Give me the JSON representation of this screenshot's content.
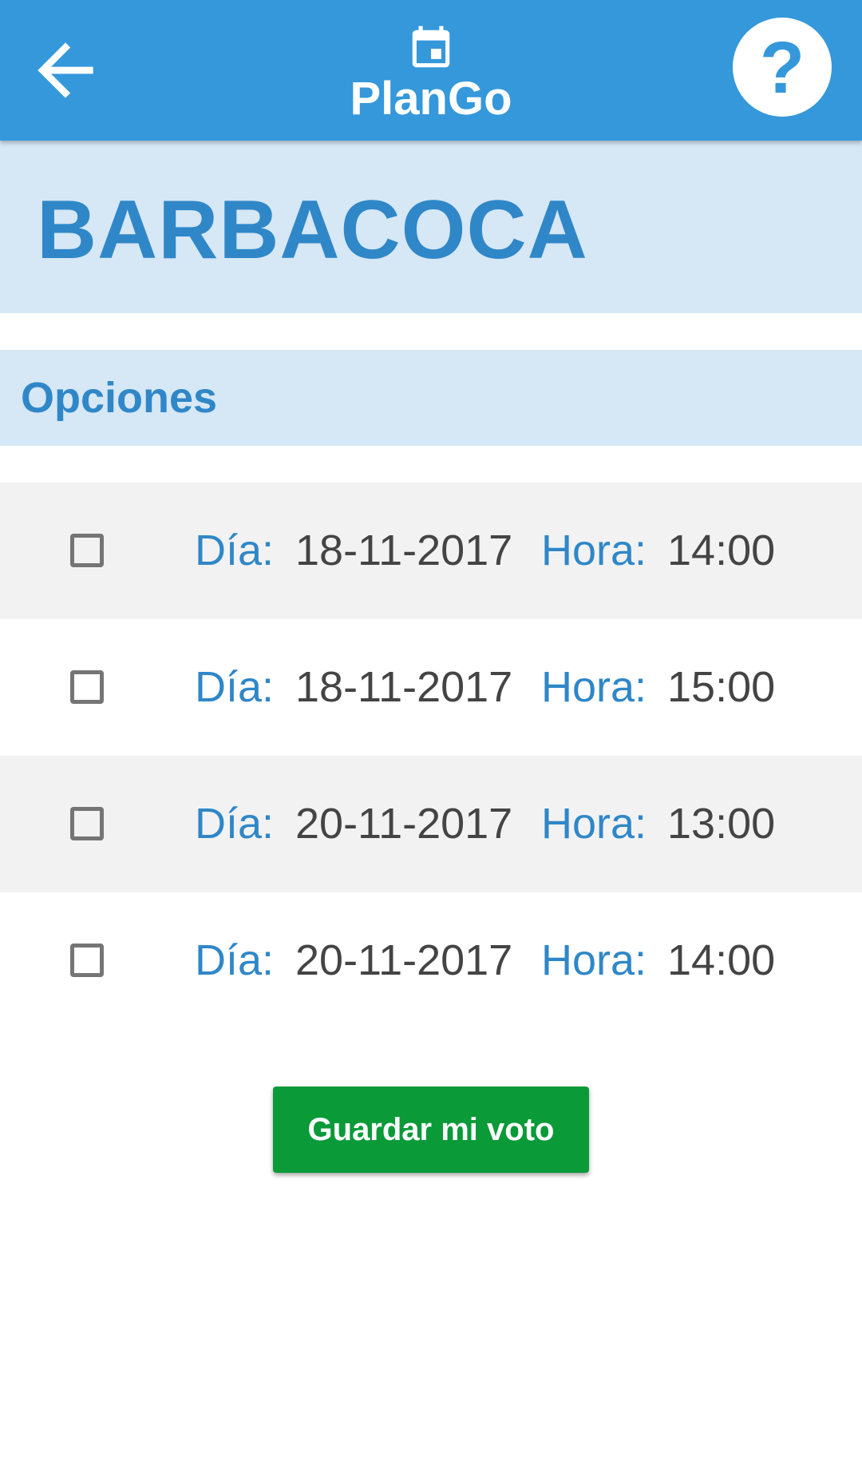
{
  "app_bar": {
    "title": "PlanGo",
    "back_icon": "arrow-back-icon",
    "calendar_icon": "calendar-icon",
    "help_label": "?",
    "color": "#3598db"
  },
  "event": {
    "name": "BARBACOCA"
  },
  "section": {
    "label": "Opciones"
  },
  "options": [
    {
      "day_label": "Día:",
      "day": "18-11-2017",
      "hour_label": "Hora:",
      "hour": "14:00",
      "checked": false
    },
    {
      "day_label": "Día:",
      "day": "18-11-2017",
      "hour_label": "Hora:",
      "hour": "15:00",
      "checked": false
    },
    {
      "day_label": "Día:",
      "day": "20-11-2017",
      "hour_label": "Hora:",
      "hour": "13:00",
      "checked": false
    },
    {
      "day_label": "Día:",
      "day": "20-11-2017",
      "hour_label": "Hora:",
      "hour": "14:00",
      "checked": false
    }
  ],
  "actions": {
    "save_label": "Guardar mi voto",
    "save_color": "#0a9a38"
  }
}
